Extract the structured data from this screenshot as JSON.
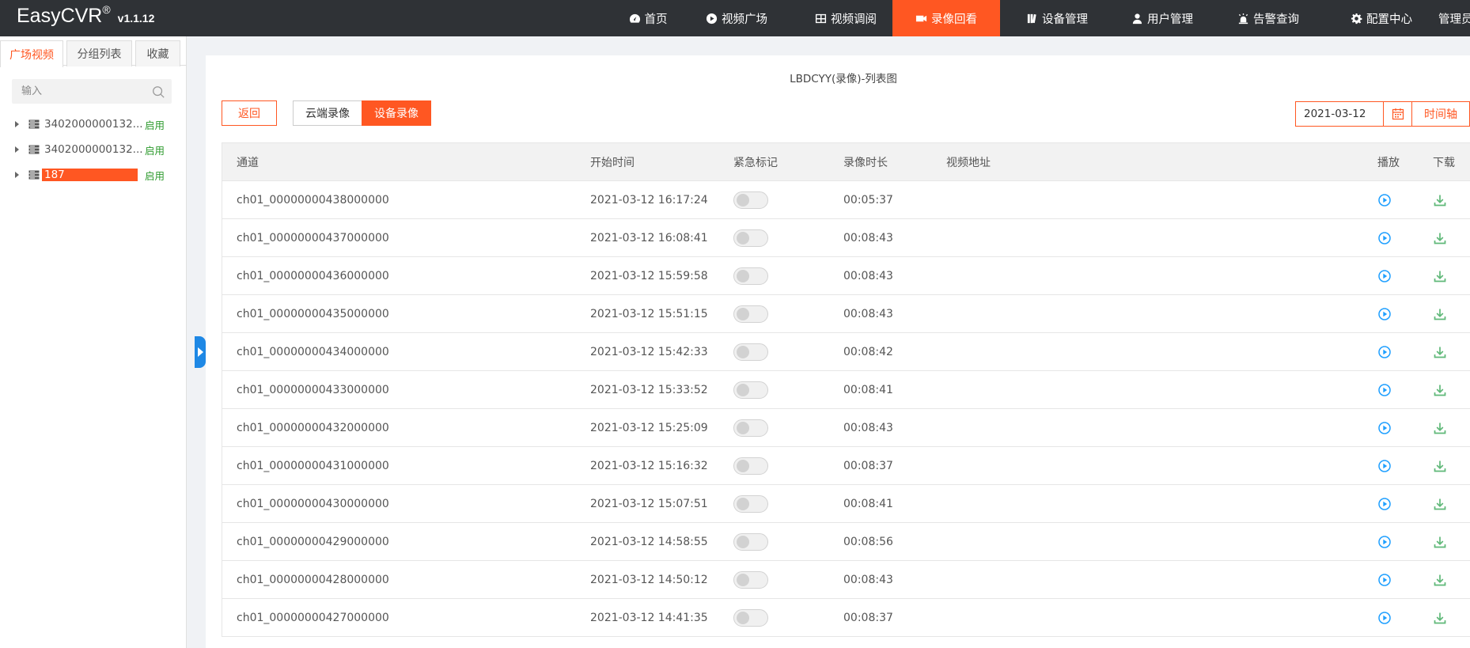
{
  "brand": {
    "name": "EasyCVR",
    "reg": "®",
    "version": "v1.1.12"
  },
  "nav": [
    {
      "label": "首页",
      "icon": "dashboard-icon"
    },
    {
      "label": "视频广场",
      "icon": "play-circle-icon"
    },
    {
      "label": "视频调阅",
      "icon": "grid-icon"
    },
    {
      "label": "录像回看",
      "icon": "video-camera-icon",
      "active": true
    },
    {
      "label": "设备管理",
      "icon": "server-icon"
    },
    {
      "label": "用户管理",
      "icon": "user-icon"
    },
    {
      "label": "告警查询",
      "icon": "alarm-icon"
    },
    {
      "label": "配置中心",
      "icon": "gear-icon"
    },
    {
      "label": "管理员"
    }
  ],
  "sidebar": {
    "tabs": [
      "广场视频",
      "分组列表",
      "收藏"
    ],
    "search_placeholder": "输入",
    "tree": [
      {
        "label": "3402000000132...",
        "status": "启用"
      },
      {
        "label": "3402000000132...",
        "status": "启用"
      },
      {
        "label": "187",
        "status": "启用",
        "selected": true
      }
    ]
  },
  "panel": {
    "title": "LBDCYY(录像)-列表图",
    "back": "返回",
    "cloud": "云端录像",
    "device": "设备录像",
    "date": "2021-03-12",
    "timeline": "时间轴"
  },
  "table": {
    "headers": [
      "通道",
      "开始时间",
      "紧急标记",
      "录像时长",
      "视频地址",
      "播放",
      "下载"
    ],
    "rows": [
      {
        "channel": "ch01_00000000438000000",
        "start": "2021-03-12 16:17:24",
        "duration": "00:05:37"
      },
      {
        "channel": "ch01_00000000437000000",
        "start": "2021-03-12 16:08:41",
        "duration": "00:08:43"
      },
      {
        "channel": "ch01_00000000436000000",
        "start": "2021-03-12 15:59:58",
        "duration": "00:08:43"
      },
      {
        "channel": "ch01_00000000435000000",
        "start": "2021-03-12 15:51:15",
        "duration": "00:08:43"
      },
      {
        "channel": "ch01_00000000434000000",
        "start": "2021-03-12 15:42:33",
        "duration": "00:08:42"
      },
      {
        "channel": "ch01_00000000433000000",
        "start": "2021-03-12 15:33:52",
        "duration": "00:08:41"
      },
      {
        "channel": "ch01_00000000432000000",
        "start": "2021-03-12 15:25:09",
        "duration": "00:08:43"
      },
      {
        "channel": "ch01_00000000431000000",
        "start": "2021-03-12 15:16:32",
        "duration": "00:08:37"
      },
      {
        "channel": "ch01_00000000430000000",
        "start": "2021-03-12 15:07:51",
        "duration": "00:08:41"
      },
      {
        "channel": "ch01_00000000429000000",
        "start": "2021-03-12 14:58:55",
        "duration": "00:08:56"
      },
      {
        "channel": "ch01_00000000428000000",
        "start": "2021-03-12 14:50:12",
        "duration": "00:08:43"
      },
      {
        "channel": "ch01_00000000427000000",
        "start": "2021-03-12 14:41:35",
        "duration": "00:08:37"
      }
    ]
  },
  "colors": {
    "accent": "#ff5722",
    "topbar": "#2f3236",
    "play": "#1e9fff",
    "download": "#5fb878",
    "enabled": "#2d9a2d"
  }
}
